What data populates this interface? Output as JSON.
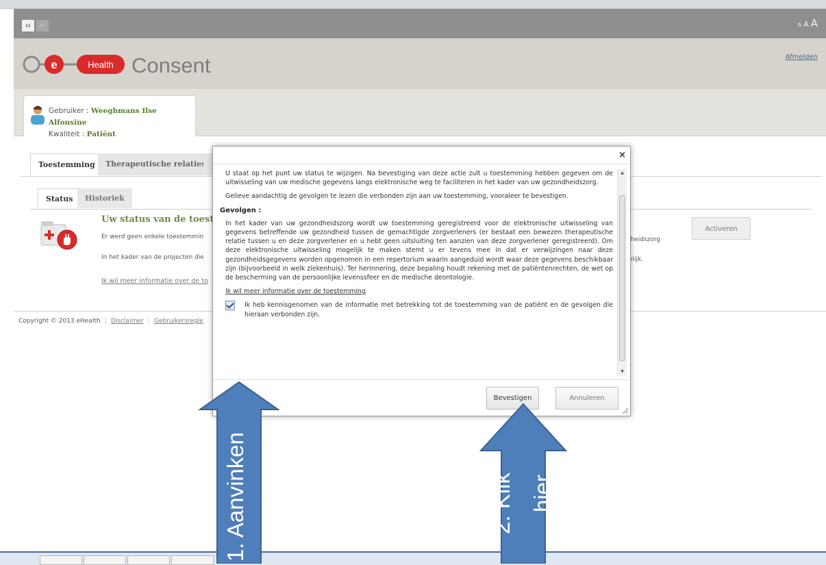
{
  "language": {
    "nl": "nl",
    "fr": "fr"
  },
  "font_size": {
    "small": "A",
    "medium": "A",
    "large": "A"
  },
  "header": {
    "logo_e": "e",
    "logo_health": "Health",
    "logo_consent": "Consent",
    "logout": "Afmelden"
  },
  "user": {
    "user_label": "Gebruiker :",
    "user_name": "Weeghmans Ilse Alfonsine",
    "quality_label": "Kwaliteit :",
    "quality_value": "Patiënt"
  },
  "tabs": {
    "consent": "Toestemming",
    "relations": "Therapeutische relaties"
  },
  "subtabs": {
    "status": "Status",
    "history": "Historiek"
  },
  "status": {
    "title": "Uw status van de toestem",
    "line1": "Er werd geen enkele toestemmin",
    "line2": "In het kader van de projecten die",
    "link": "Ik wil meer informatie over de to",
    "right1": "lheidszorg",
    "right2": "elijk.",
    "activate": "Activeren"
  },
  "footer": {
    "copyright": "Copyright © 2013 eHealth",
    "disclaimer": "Disclaimer",
    "terms": "Gebruikersregle"
  },
  "dialog": {
    "close": "×",
    "intro": "U staat op het punt uw status te wijzigen. Na bevestiging van deze actie zult u toestemming hebben gegeven om de uitwisseling van uw medische gegevens langs elektronische weg te faciliteren in het kader van uw gezondheidszorg.",
    "read_carefully": "Gelieve aandachtig de gevolgen te lezen die verbonden zijn aan uw toestemming, vooraleer te bevestigen.",
    "consequences_heading": "Gevolgen :",
    "consequences": "In het kader van uw gezondheidszorg wordt uw toestemming geregistreerd voor de elektronische uitwisseling van gegevens betreffende uw gezondheid tussen de gemachtigde zorgverleners (er bestaat een bewezen therapeutische relatie tussen u en deze zorgverlener en u hebt geen uitsluiting ten aanzien van deze zorgverlener geregistreerd). Om deze elektronische uitwisseling mogelijk te maken stemt u er tevens mee in dat er verwijzingen naar deze gezondheidsgegevens worden opgenomen in een repertorium waarin aangeduid wordt waar deze gegevens beschikbaar zijn (bijvoorbeeld in welk ziekenhuis). Ter herinnering, deze bepaling houdt rekening met de patiëntenrechten, de wet op de bescherming van de persoonlijke levenssfeer en de medische deontologie.",
    "more_info": "Ik wil meer informatie over de toestemming",
    "checkbox_label": "Ik heb kennisgenomen van de informatie met betrekking tot de toestemming van de patiënt en de gevolgen die hieraan verbonden zijn.",
    "checkbox_checked": true,
    "confirm": "Bevestigen",
    "cancel": "Annuleren"
  },
  "annotations": {
    "step1": "1. Aanvinken",
    "step2_line1": "2. Klik",
    "step2_line2": "hier",
    "arrow_color": "#4f7fba"
  },
  "colors": {
    "brand_red": "#d92b2b",
    "brand_green": "#6f8c3e",
    "link_blue": "#4a6b8a"
  }
}
